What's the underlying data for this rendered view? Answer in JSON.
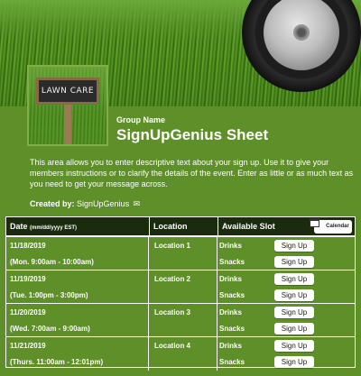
{
  "banner": {
    "sign_text": "LAWN CARE"
  },
  "header": {
    "group_label": "Group Name",
    "title": "SignUpGenius Sheet"
  },
  "description": "This area allows you to enter descriptive text about your sign up. Use it to give your members instructions or to clarify the details of the event. Enter as little or as much text as you need to get your message across.",
  "created_by": {
    "label": "Created by:",
    "name": "SignUpGenius"
  },
  "table": {
    "headers": {
      "date": "Date",
      "date_hint": "(mm/dd/yyyy EST)",
      "location": "Location",
      "slot": "Available Slot",
      "calendar": "Calendar"
    },
    "rows": [
      {
        "date": "11/18/2019",
        "time": "(Mon. 9:00am - 10:00am)",
        "location": "Location 1",
        "slot1": "Drinks",
        "slot2": "Snacks",
        "button": "Sign Up"
      },
      {
        "date": "11/19/2019",
        "time": "(Tue. 1:00pm - 3:00pm)",
        "location": "Location 2",
        "slot1": "Drinks",
        "slot2": "Snacks",
        "button": "Sign Up"
      },
      {
        "date": "11/20/2019",
        "time": "(Wed. 7:00am - 9:00am)",
        "location": "Location 3",
        "slot1": "Drinks",
        "slot2": "Snacks",
        "button": "Sign Up"
      },
      {
        "date": "11/21/2019",
        "time": "(Thurs. 11:00am - 12:01pm)",
        "location": "Location 4",
        "slot1": "Drinks",
        "slot2": "Snacks",
        "button": "Sign Up"
      }
    ]
  },
  "colors": {
    "background": "#5e8f28",
    "header_bar": "#1b2c0e",
    "text": "#ffffff"
  }
}
